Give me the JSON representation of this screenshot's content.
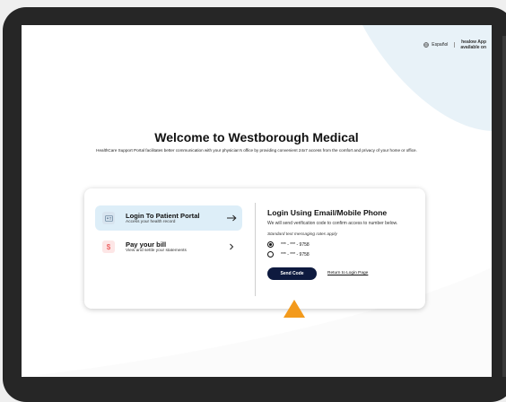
{
  "header": {
    "language_label": "Español",
    "app_line1": "healow App",
    "app_line2": "available on"
  },
  "main": {
    "title": "Welcome to Westborough Medical",
    "description": "HealthCare Support Portal facilitates better communication with your physician's office by providing convenient 24x7 access from the comfort and privacy of your home or office."
  },
  "options": [
    {
      "title": "Login To Patient Portal",
      "subtitle": "Access your health record",
      "icon": "portal-card-icon"
    },
    {
      "title": "Pay your bill",
      "subtitle": "View and settle your statements",
      "icon_text": "$"
    }
  ],
  "login": {
    "title": "Login Using Email/Mobile Phone",
    "subtitle": "We will send verification code to confirm access to number below.",
    "note": "Standard text messaging rates apply",
    "phones": [
      {
        "label": "*** - *** - 9758",
        "selected": true
      },
      {
        "label": "*** - *** - 9758",
        "selected": false
      }
    ],
    "send_button": "Send Code",
    "return_link": "Return to Login Page"
  },
  "colors": {
    "accent": "#0e1a3f",
    "selected_option_bg": "#ddeef8",
    "pointer": "#f39a1c",
    "bg_shape": "#e8f2f8"
  }
}
